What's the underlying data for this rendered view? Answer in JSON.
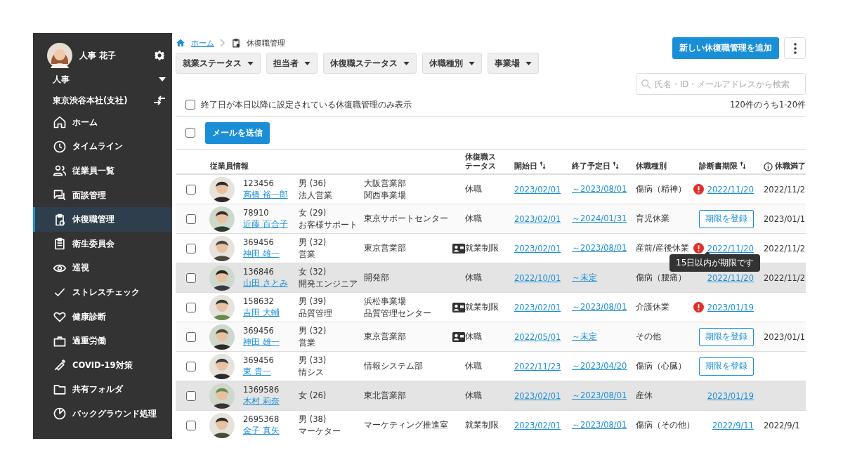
{
  "sidebar": {
    "user_name": "人事 花子",
    "role": "人事",
    "office": "東京渋谷本社(支社)",
    "items": [
      {
        "label": "ホーム",
        "selected": false
      },
      {
        "label": "タイムライン",
        "selected": false
      },
      {
        "label": "従業員一覧",
        "selected": false
      },
      {
        "label": "面談管理",
        "selected": false
      },
      {
        "label": "休復職管理",
        "selected": true
      },
      {
        "label": "衛生委員会",
        "selected": false
      },
      {
        "label": "巡視",
        "selected": false
      },
      {
        "label": "ストレスチェック",
        "selected": false
      },
      {
        "label": "健康診断",
        "selected": false
      },
      {
        "label": "過重労働",
        "selected": false
      },
      {
        "label": "COVID-19対策",
        "selected": false
      },
      {
        "label": "共有フォルダ",
        "selected": false
      },
      {
        "label": "バックグラウンド処理",
        "selected": false
      }
    ]
  },
  "breadcrumb": {
    "home": "ホーム",
    "current": "休復職管理"
  },
  "filters": [
    "就業ステータス",
    "担当者",
    "休復職ステータス",
    "休職種別",
    "事業場"
  ],
  "add_button": "新しい休復職管理を追加",
  "search": {
    "placeholder": "氏名・ID・メールアドレスから検索"
  },
  "future_only": {
    "label": "終了日が本日以降に設定されている休復職管理のみ表示",
    "checked": false
  },
  "count": "120件のうち1-20件",
  "select_all": {
    "checked": false
  },
  "mail_button": "メールを送信",
  "table": {
    "columns": [
      {
        "label": "従業員情報",
        "sortable": false
      },
      {
        "label": "休復職ステータス",
        "sortable": false
      },
      {
        "label": "開始日",
        "sortable": true
      },
      {
        "label": "終了予定日",
        "sortable": true
      },
      {
        "label": "休職種別",
        "sortable": false
      },
      {
        "label": "診断書期限",
        "sortable": true
      },
      {
        "label": "休職満了",
        "sortable": false
      }
    ],
    "rows": [
      {
        "checked": false,
        "highlighted": false,
        "id": "123456",
        "name": "高橋 裕一郎",
        "gender_age": "男 (36)",
        "job": "法人営業",
        "dept": [
          "大阪営業部",
          "関西事業場"
        ],
        "card": false,
        "status": "休職",
        "start": "2023/02/01",
        "end": "～2023/08/01",
        "leave_type": "傷病（精神）",
        "cert": {
          "kind": "date",
          "text": "2022/11/20",
          "alert": true
        },
        "expiry": "2022/11/2"
      },
      {
        "checked": false,
        "highlighted": false,
        "id": "78910",
        "name": "近藤 百合子",
        "gender_age": "女 (29)",
        "job": "お客様サポート",
        "dept": [
          "東京サポートセンター"
        ],
        "card": false,
        "status": "休職",
        "start": "2023/02/01",
        "end": "～2024/01/31",
        "leave_type": "育児休業",
        "cert": {
          "kind": "button",
          "text": "期限を登録"
        },
        "expiry": "2023/01/1"
      },
      {
        "checked": false,
        "highlighted": false,
        "id": "369456",
        "name": "神田 雄一",
        "gender_age": "男 (32)",
        "job": "営業",
        "dept": [
          "東京営業部"
        ],
        "card": true,
        "status": "就業制限",
        "start": "2023/02/01",
        "end": "～2023/08/01",
        "leave_type": "産前/産後休業",
        "cert": {
          "kind": "date",
          "text": "2022/11/20",
          "alert": true,
          "tooltip": "15日以内が期限です"
        },
        "expiry": "2022/11/2"
      },
      {
        "checked": false,
        "highlighted": true,
        "id": "136846",
        "name": "山田 さとみ",
        "gender_age": "女 (32)",
        "job": "開発エンジニア",
        "dept": [
          "開発部"
        ],
        "card": false,
        "status": "休職",
        "start": "2022/10/01",
        "end": "～未定",
        "leave_type": "傷病（腰痛）",
        "cert": {
          "kind": "date",
          "text": "2022/11/20",
          "alert": false
        },
        "expiry": "2022/11/2"
      },
      {
        "checked": false,
        "highlighted": false,
        "id": "158632",
        "name": "吉田 大輔",
        "gender_age": "男 (39)",
        "job": "品質管理",
        "dept": [
          "浜松事業場",
          "品質管理センター"
        ],
        "card": true,
        "status": "就業制限",
        "start": "2023/02/01",
        "end": "～2023/08/01",
        "leave_type": "介護休業",
        "cert": {
          "kind": "date",
          "text": "2023/01/19",
          "alert": true
        }
      },
      {
        "checked": false,
        "highlighted": false,
        "id": "369456",
        "name": "神田 雄一",
        "gender_age": "男 (32)",
        "job": "営業",
        "dept": [
          "東京営業部"
        ],
        "card": true,
        "status": "休職",
        "start": "2022/05/01",
        "end": "～未定",
        "leave_type": "その他",
        "cert": {
          "kind": "button",
          "text": "期限を登録"
        },
        "expiry": "2023/01/1"
      },
      {
        "checked": false,
        "highlighted": false,
        "id": "369456",
        "name": "東 貴一",
        "gender_age": "男 (33)",
        "job": "情シス",
        "dept": [
          "情報システム部"
        ],
        "card": false,
        "status": "休職",
        "start": "2022/11/23",
        "end": "～2023/04/20",
        "leave_type": "傷病（心臓）",
        "cert": {
          "kind": "button",
          "text": "期限を登録"
        }
      },
      {
        "checked": false,
        "highlighted": true,
        "id": "1369586",
        "name": "木村 莉奈",
        "gender_age": "女 (26)",
        "dept": [
          "東北営業部"
        ],
        "card": false,
        "status": "休職",
        "start": "2023/02/01",
        "end": "～2023/08/01",
        "leave_type": "産休",
        "cert": {
          "kind": "date",
          "text": "2023/01/19",
          "alert": false
        }
      },
      {
        "checked": false,
        "highlighted": false,
        "id": "2695368",
        "name": "金子 真矢",
        "gender_age": "男 (38)",
        "job": "マーケター",
        "dept": [
          "マーケティング推進室"
        ],
        "card": false,
        "status": "就業制限",
        "start": "2023/02/01",
        "end": "～2023/08/01",
        "leave_type": "傷病（その他）",
        "cert": {
          "kind": "date",
          "text": "2022/9/11",
          "alert": false
        },
        "expiry": "2022/9/1"
      }
    ]
  }
}
